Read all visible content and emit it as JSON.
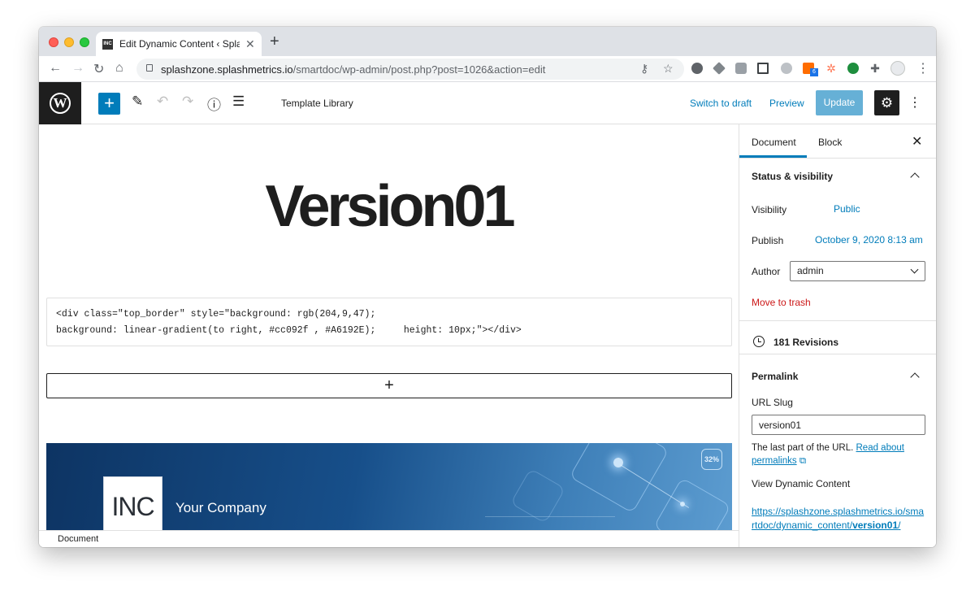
{
  "browser": {
    "tab_title": "Edit Dynamic Content ‹ Splash",
    "tab_favicon": "INC",
    "url_host": "splashzone.splashmetrics.io",
    "url_path": "/smartdoc/wp-admin/post.php?post=1026&action=edit",
    "ext_badge": "6"
  },
  "editor_header": {
    "template_library": "Template Library",
    "switch_to_draft": "Switch to draft",
    "preview": "Preview",
    "update": "Update"
  },
  "canvas": {
    "heading": "Version01",
    "html_line1": "<div class=\"top_border\" style=\"background: rgb(204,9,47);",
    "html_line2": "background: linear-gradient(to right, #cc092f , #A6192E);     height: 10px;\"></div>",
    "banner_badge": "32%",
    "banner_logo": "INC",
    "banner_company": "Your Company",
    "footer_breadcrumb": "Document"
  },
  "sidebar": {
    "tab_document": "Document",
    "tab_block": "Block",
    "status_title": "Status & visibility",
    "visibility_label": "Visibility",
    "visibility_value": "Public",
    "publish_label": "Publish",
    "publish_value": "October 9, 2020 8:13 am",
    "author_label": "Author",
    "author_value": "admin",
    "move_to_trash": "Move to trash",
    "revisions": "181 Revisions",
    "permalink_title": "Permalink",
    "url_slug_label": "URL Slug",
    "url_slug_value": "version01",
    "help_text": "The last part of the URL.",
    "help_link": "Read about permalinks",
    "view_label": "View Dynamic Content",
    "view_link_prefix": "https://splashzone.splashmetrics.io/smartdoc/dynamic_content/",
    "view_link_slug": "version01",
    "view_link_suffix": "/"
  },
  "colors": {
    "accent": "#007cba",
    "update_disabled": "#66b0d6",
    "trash": "#cc1818",
    "wp_dark": "#1e1e1e"
  }
}
